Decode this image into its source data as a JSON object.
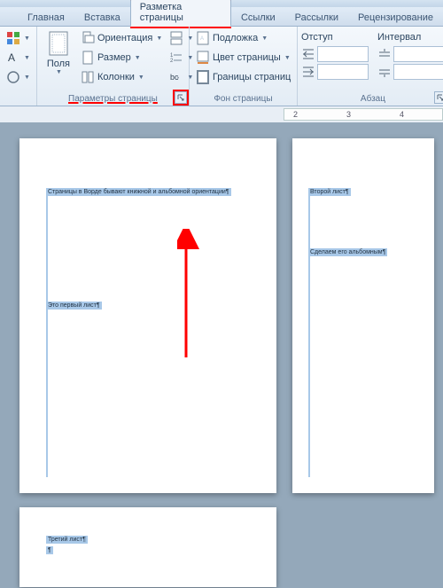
{
  "tabs": {
    "glavnaya": "Главная",
    "vstavka": "Вставка",
    "razmetka": "Разметка страницы",
    "ssylki": "Ссылки",
    "rassylki": "Рассылки",
    "retsenz": "Рецензирование"
  },
  "ribbon": {
    "themes": {
      "label": ""
    },
    "page_setup": {
      "label": "Параметры страницы",
      "polya": "Поля",
      "orient": "Ориентация",
      "razmer": "Размер",
      "kolonki": "Колонки",
      "razryvy": "",
      "nomera": "",
      "rasstan": "bc"
    },
    "bg": {
      "label": "Фон страницы",
      "podlozhka": "Подложка",
      "tsvet": "Цвет страницы",
      "granitsy": "Границы страниц"
    },
    "par": {
      "otstup": "Отступ",
      "interval": "Интервал",
      "label": "Абзац"
    }
  },
  "ruler": {
    "t2": "2",
    "t3": "3",
    "t4": "4"
  },
  "doc": {
    "p1_line1": "Страницы в Ворде бывают книжной и альбомной ориентации¶",
    "p1_line2": "Это первый лист¶",
    "p2_line1": "Второй лист¶",
    "p2_line2": "Сделаем его альбомным¶",
    "p3_line1": "Третий лист¶",
    "p3_line2": "¶"
  }
}
